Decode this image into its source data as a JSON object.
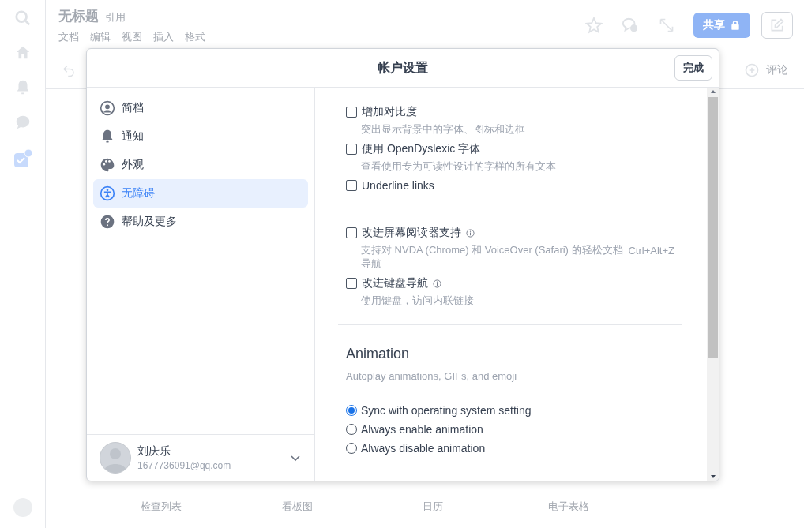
{
  "app": {
    "title": "无标题",
    "cite": "引用",
    "menu": [
      "文档",
      "编辑",
      "视图",
      "插入",
      "格式"
    ],
    "share": "共享",
    "comment": "评论",
    "tiles": [
      "检查列表",
      "看板图",
      "日历",
      "电子表格"
    ]
  },
  "dialog": {
    "title": "帐户设置",
    "done": "完成",
    "nav": [
      {
        "kind": "profile",
        "label": "简档",
        "selected": false
      },
      {
        "kind": "bell",
        "label": "通知",
        "selected": false
      },
      {
        "kind": "palette",
        "label": "外观",
        "selected": false
      },
      {
        "kind": "accessibility",
        "label": "无障碍",
        "selected": true
      },
      {
        "kind": "help",
        "label": "帮助及更多",
        "selected": false
      }
    ],
    "user": {
      "name": "刘庆乐",
      "email": "1677736091@qq.com"
    },
    "sections": [
      {
        "options": [
          {
            "label": "增加对比度",
            "info": false,
            "checked": false,
            "description": "突出显示背景中的字体、图标和边框"
          },
          {
            "label": "使用 OpenDyslexic 字体",
            "info": false,
            "checked": false,
            "description": "查看使用专为可读性设计的字样的所有文本"
          },
          {
            "label": "Underline links",
            "info": false,
            "checked": false
          }
        ]
      },
      {
        "options": [
          {
            "label": "改进屏幕阅读器支持",
            "info": true,
            "checked": false,
            "description": "支持对 NVDA (Chrome) 和 VoiceOver (Safari) 的轻松文档导航",
            "shortcut": "Ctrl+Alt+Z"
          },
          {
            "label": "改进键盘导航",
            "info": true,
            "checked": false,
            "description": "使用键盘，访问内联链接"
          }
        ]
      }
    ],
    "animation": {
      "heading": "Animation",
      "description": "Autoplay animations, GIFs, and emoji",
      "choices": [
        {
          "label": "Sync with operating system setting",
          "selected": true
        },
        {
          "label": "Always enable animation",
          "selected": false
        },
        {
          "label": "Always disable animation",
          "selected": false
        }
      ]
    }
  }
}
